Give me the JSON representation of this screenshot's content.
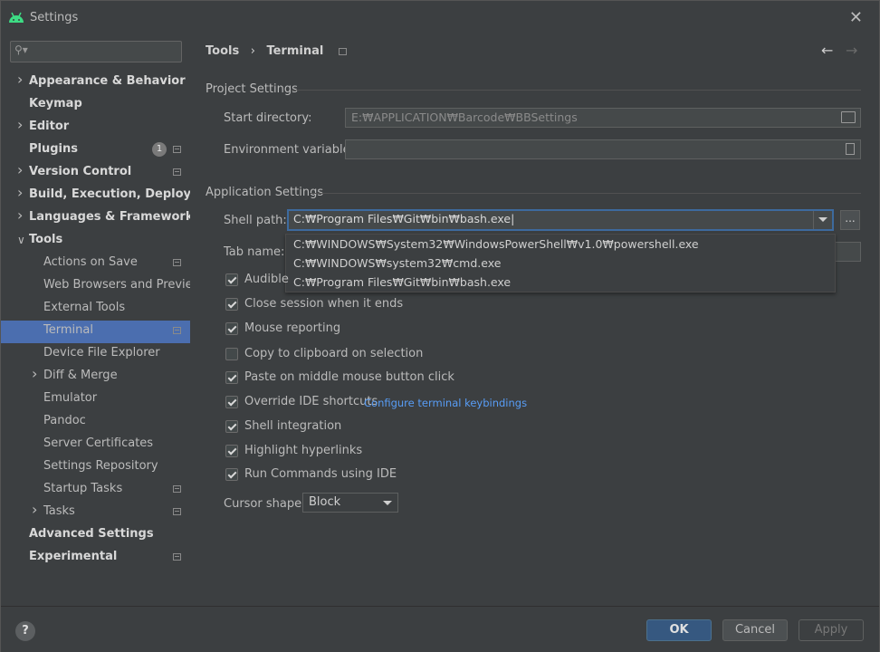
{
  "window": {
    "title": "Settings"
  },
  "search": {
    "placeholder": ""
  },
  "sidebar": {
    "items": [
      {
        "label": "Appearance & Behavior",
        "level": 0,
        "bold": true,
        "arrow": ">",
        "project": false
      },
      {
        "label": "Keymap",
        "level": 0,
        "bold": true,
        "arrow": "",
        "project": false
      },
      {
        "label": "Editor",
        "level": 0,
        "bold": true,
        "arrow": ">",
        "project": false
      },
      {
        "label": "Plugins",
        "level": 0,
        "bold": true,
        "arrow": "",
        "project": true,
        "badge": "1"
      },
      {
        "label": "Version Control",
        "level": 0,
        "bold": true,
        "arrow": ">",
        "project": true
      },
      {
        "label": "Build, Execution, Deployment",
        "level": 0,
        "bold": true,
        "arrow": ">",
        "project": false
      },
      {
        "label": "Languages & Frameworks",
        "level": 0,
        "bold": true,
        "arrow": ">",
        "project": false
      },
      {
        "label": "Tools",
        "level": 0,
        "bold": true,
        "arrow": "v",
        "project": false
      },
      {
        "label": "Actions on Save",
        "level": 1,
        "bold": false,
        "arrow": "",
        "project": true
      },
      {
        "label": "Web Browsers and Preview",
        "level": 1,
        "bold": false,
        "arrow": "",
        "project": false
      },
      {
        "label": "External Tools",
        "level": 1,
        "bold": false,
        "arrow": "",
        "project": false
      },
      {
        "label": "Terminal",
        "level": 1,
        "bold": false,
        "arrow": "",
        "project": true,
        "selected": true
      },
      {
        "label": "Device File Explorer",
        "level": 1,
        "bold": false,
        "arrow": "",
        "project": false
      },
      {
        "label": "Diff & Merge",
        "level": 1,
        "bold": false,
        "arrow": ">",
        "project": false
      },
      {
        "label": "Emulator",
        "level": 1,
        "bold": false,
        "arrow": "",
        "project": false
      },
      {
        "label": "Pandoc",
        "level": 1,
        "bold": false,
        "arrow": "",
        "project": false
      },
      {
        "label": "Server Certificates",
        "level": 1,
        "bold": false,
        "arrow": "",
        "project": false
      },
      {
        "label": "Settings Repository",
        "level": 1,
        "bold": false,
        "arrow": "",
        "project": false
      },
      {
        "label": "Startup Tasks",
        "level": 1,
        "bold": false,
        "arrow": "",
        "project": true
      },
      {
        "label": "Tasks",
        "level": 1,
        "bold": false,
        "arrow": ">",
        "project": true
      },
      {
        "label": "Advanced Settings",
        "level": 0,
        "bold": true,
        "arrow": "",
        "project": false
      },
      {
        "label": "Experimental",
        "level": 0,
        "bold": true,
        "arrow": "",
        "project": true
      }
    ]
  },
  "breadcrumb": {
    "parent": "Tools",
    "separator": "›",
    "current": "Terminal"
  },
  "project_settings": {
    "title": "Project Settings",
    "start_directory_label": "Start directory:",
    "start_directory_value": "E:₩APPLICATION₩Barcode₩BBSettings",
    "env_vars_label": "Environment variables:",
    "env_vars_value": ""
  },
  "application_settings": {
    "title": "Application Settings",
    "shell_path_label": "Shell path:",
    "shell_path_value": "C:₩Program Files₩Git₩bin₩bash.exe",
    "ellipsis": "...",
    "tab_name_label": "Tab name:",
    "shell_options": [
      "C:₩WINDOWS₩System32₩WindowsPowerShell₩v1.0₩powershell.exe",
      "C:₩WINDOWS₩system32₩cmd.exe",
      "C:₩Program Files₩Git₩bin₩bash.exe"
    ],
    "checkboxes": [
      {
        "label": "Audible",
        "checked": true
      },
      {
        "label": "Close session when it ends",
        "checked": true
      },
      {
        "label": "Mouse reporting",
        "checked": true
      },
      {
        "label": "Copy to clipboard on selection",
        "checked": false
      },
      {
        "label": "Paste on middle mouse button click",
        "checked": true
      },
      {
        "label": "Override IDE shortcuts",
        "checked": true
      },
      {
        "label": "Shell integration",
        "checked": true
      },
      {
        "label": "Highlight hyperlinks",
        "checked": true
      },
      {
        "label": "Run Commands using IDE",
        "checked": true
      }
    ],
    "configure_link": "Configure terminal keybindings",
    "cursor_shape_label": "Cursor shape:",
    "cursor_shape_value": "Block"
  },
  "footer": {
    "help": "?",
    "ok": "OK",
    "cancel": "Cancel",
    "apply": "Apply"
  },
  "colors": {
    "selection": "#4b6eaf",
    "link": "#589df6",
    "ok_button": "#365880",
    "background": "#3c3f41"
  }
}
